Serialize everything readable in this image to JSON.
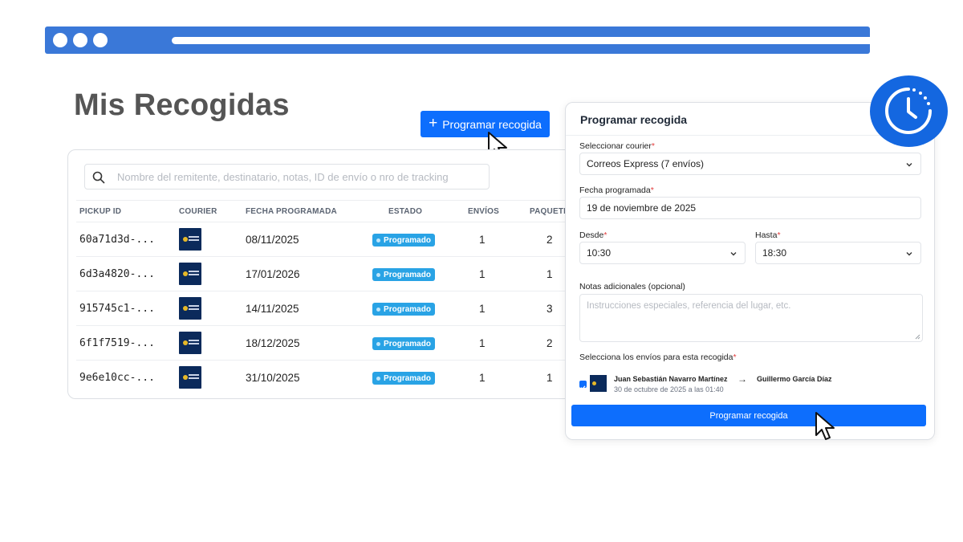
{
  "page": {
    "title": "Mis Recogidas",
    "add_button_label": "Programar recogida",
    "add_button_icon": "plus-icon"
  },
  "search": {
    "placeholder": "Nombre del remitente, destinatario, notas, ID de envío o nro de tracking",
    "value": ""
  },
  "table": {
    "headers": [
      "PICKUP ID",
      "COURIER",
      "FECHA PROGRAMADA",
      "ESTADO",
      "ENVÍOS",
      "PAQUETES"
    ],
    "rows": [
      {
        "id": "60a71d3d-...",
        "date": "08/11/2025",
        "status": "Programado",
        "shipments": "1",
        "packages": "2"
      },
      {
        "id": "6d3a4820-...",
        "date": "17/01/2026",
        "status": "Programado",
        "shipments": "1",
        "packages": "1"
      },
      {
        "id": "915745c1-...",
        "date": "14/11/2025",
        "status": "Programado",
        "shipments": "1",
        "packages": "3"
      },
      {
        "id": "6f1f7519-...",
        "date": "18/12/2025",
        "status": "Programado",
        "shipments": "1",
        "packages": "2"
      },
      {
        "id": "9e6e10cc-...",
        "date": "31/10/2025",
        "status": "Programado",
        "shipments": "1",
        "packages": "1"
      }
    ]
  },
  "modal": {
    "title": "Programar recogida",
    "courier_label": "Seleccionar courier",
    "courier_value": "Correos Express (7 envíos)",
    "date_label": "Fecha programada",
    "date_value": "19 de noviembre de 2025",
    "from_label": "Desde",
    "from_value": "10:30",
    "to_label": "Hasta",
    "to_value": "18:30",
    "notes_label": "Notas adicionales (opcional)",
    "notes_placeholder": "Instrucciones especiales, referencia del lugar, etc.",
    "shipments_label": "Selecciona los envíos para esta recogida",
    "shipment": {
      "sender": "Juan Sebastián Navarro Martínez",
      "arrow": "→",
      "recipient": "Guillermo García Díaz",
      "date": "30 de octubre de 2025 a las 01:40"
    },
    "submit_label": "Programar recogida",
    "required_mark": "*"
  },
  "colors": {
    "primary": "#0d6efd",
    "browser_bar": "#3a78d8",
    "badge": "#29a3e5",
    "clock": "#1467e0",
    "title_gray": "#555555"
  }
}
